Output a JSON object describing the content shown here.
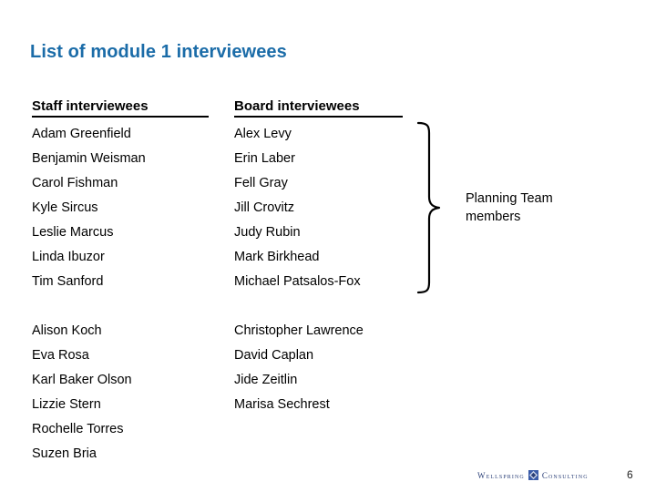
{
  "slide": {
    "title": "List of module 1 interviewees",
    "title_color": "#1B6CA8",
    "background": "#ffffff"
  },
  "columns": {
    "staff_header": "Staff interviewees",
    "board_header": "Board interviewees"
  },
  "staff_group_1": [
    "Adam Greenfield",
    "Benjamin Weisman",
    "Carol Fishman",
    "Kyle Sircus",
    "Leslie Marcus",
    "Linda Ibuzor",
    "Tim Sanford"
  ],
  "board_group_1": [
    "Alex Levy",
    "Erin Laber",
    "Fell Gray",
    "Jill Crovitz",
    "Judy Rubin",
    "Mark Birkhead",
    "Michael Patsalos-Fox"
  ],
  "staff_group_2": [
    "Alison Koch",
    "Eva Rosa",
    "Karl Baker Olson",
    "Lizzie Stern",
    "Rochelle Torres",
    "Suzen Bria"
  ],
  "board_group_2": [
    "Christopher Lawrence",
    "David Caplan",
    "Jide Zeitlin",
    "Marisa Sechrest"
  ],
  "callout": {
    "line1": "Planning Team",
    "line2": "members",
    "icon": "curly-brace-icon"
  },
  "footer": {
    "logo_word_1": "Wellspring",
    "logo_word_2": "Consulting",
    "logo_mark": "diamond-logo-icon",
    "logo_color": "#2A3F77",
    "logo_mark_color": "#3A5BA8",
    "page_number": "6"
  }
}
